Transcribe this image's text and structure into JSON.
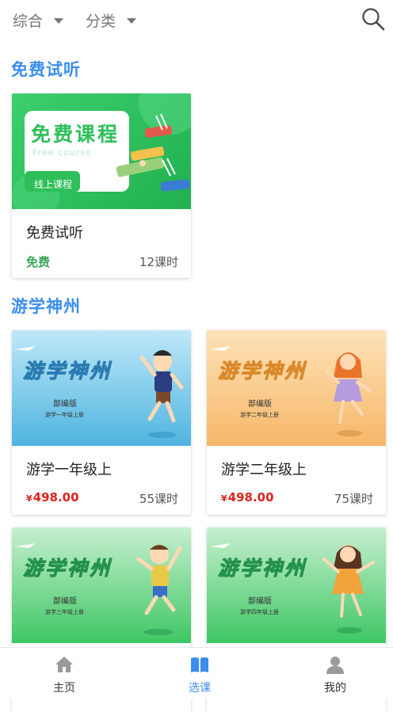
{
  "filters": [
    {
      "label": "综合"
    },
    {
      "label": "分类"
    }
  ],
  "sections": {
    "free": {
      "title": "免费试听"
    },
    "travel": {
      "title": "游学神州"
    }
  },
  "free_card": {
    "cover_title": "免费课程",
    "cover_subtitle": "Free course",
    "cover_tag": "线上课程",
    "name": "免费试听",
    "price": "免费",
    "lessons": "12课时"
  },
  "courses": [
    {
      "cover_title": "游学神州",
      "cover_edition": "部编版",
      "cover_grade": "游学一年级上册",
      "name": "游学一年级上",
      "currency": "¥",
      "price": "498.00",
      "lessons": "55课时"
    },
    {
      "cover_title": "游学神州",
      "cover_edition": "部编版",
      "cover_grade": "游学二年级上册",
      "name": "游学二年级上",
      "currency": "¥",
      "price": "498.00",
      "lessons": "75课时"
    },
    {
      "cover_title": "游学神州",
      "cover_edition": "部编版",
      "cover_grade": "游学三年级上册"
    },
    {
      "cover_title": "游学神州",
      "cover_edition": "部编版",
      "cover_grade": "游学四年级上册"
    }
  ],
  "nav": [
    {
      "label": "主页",
      "icon": "home-icon"
    },
    {
      "label": "选课",
      "icon": "book-icon"
    },
    {
      "label": "我的",
      "icon": "user-icon"
    }
  ],
  "colors": {
    "accent": "#3b8df0",
    "price": "#d9261c",
    "free": "#3aa659"
  }
}
